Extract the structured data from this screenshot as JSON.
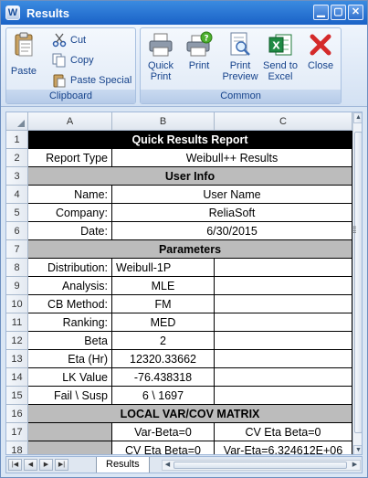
{
  "window": {
    "title": "Results",
    "app_icon_letter": "W"
  },
  "ribbon": {
    "clipboard": {
      "label": "Clipboard",
      "paste": "Paste",
      "cut": "Cut",
      "copy": "Copy",
      "paste_special": "Paste Special"
    },
    "common": {
      "label": "Common",
      "quick_print": "Quick\nPrint",
      "print": "Print",
      "print_preview": "Print\nPreview",
      "send_to_excel": "Send to\nExcel",
      "close": "Close"
    }
  },
  "sheet": {
    "columns": [
      "A",
      "B",
      "C"
    ],
    "rows": [
      "1",
      "2",
      "3",
      "4",
      "5",
      "6",
      "7",
      "8",
      "9",
      "10",
      "11",
      "12",
      "13",
      "14",
      "15",
      "16",
      "17",
      "18"
    ],
    "title": "Quick Results Report",
    "report_type_label": "Report Type",
    "report_type_value": "Weibull++ Results",
    "user_info": "User Info",
    "name_label": "Name:",
    "name_value": "User Name",
    "company_label": "Company:",
    "company_value": "ReliaSoft",
    "date_label": "Date:",
    "date_value": "6/30/2015",
    "parameters": "Parameters",
    "params": [
      {
        "label": "Distribution:",
        "value": "Weibull-1P"
      },
      {
        "label": "Analysis:",
        "value": "MLE"
      },
      {
        "label": "CB Method:",
        "value": "FM"
      },
      {
        "label": "Ranking:",
        "value": "MED"
      },
      {
        "label": "Beta",
        "value": "2"
      },
      {
        "label": "Eta (Hr)",
        "value": "12320.33662"
      },
      {
        "label": "LK Value",
        "value": "-76.438318"
      },
      {
        "label": "Fail \\ Susp",
        "value": "6 \\ 1697"
      }
    ],
    "matrix_title": "LOCAL VAR/COV MATRIX",
    "matrix": [
      [
        "",
        "Var-Beta=0",
        "CV Eta Beta=0"
      ],
      [
        "",
        "CV Eta Beta=0",
        "Var-Eta=6.324612E+06"
      ]
    ],
    "tab_name": "Results"
  }
}
